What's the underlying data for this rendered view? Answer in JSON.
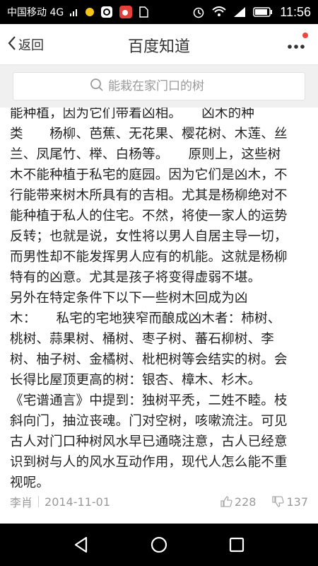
{
  "status": {
    "carrier": "中国移动 4G",
    "network": "4G",
    "time": "11:56"
  },
  "header": {
    "back_label": "返回",
    "title": "百度知道"
  },
  "search": {
    "placeholder": "能栽在家门口的树"
  },
  "article": {
    "lines": [
      "能种植，因为它们带着凶相。　　凶木的种",
      "类　　杨柳、芭蕉、无花果、樱花树、木莲、丝",
      "兰、凤尾竹、榉、白杨等。　　原则上，这些树",
      "木不能种植于私宅的庭园。因为它们是凶木，不",
      "行能带来树木所具有的吉相。尤其是杨柳绝对不",
      "能种植于私人的住宅。不然，将使一家人的运势",
      "反转；也就是说，女性将以男人自居主导一切，",
      "而男性却不能发挥男人应有的机能。这就是杨柳",
      "特有的凶意。尤其是孩子将变得虚弱不堪。",
      "另外在特定条件下以下一些树木回成为凶",
      "木：　　私宅的宅地狭窄而酿成凶木者：柿树、",
      "桃树、蒜果树、桶树、枣子树、蕃石柳树、李",
      "树、柚子树、金橘树、枇杷树等会结实的树。会",
      "长得比屋顶更高的树：银杏、樟木、杉木。",
      "《宅谱通言》中提到：独树平秃，二姓不睦。枝",
      "斜向门，抽泣丧魂。门对空树，咳嗽流注。可见",
      "古人对门口种树风水早已通晓注意，古人已经意",
      "识到树与人的风水互动作用，现代人怎么能不重",
      "视呢。"
    ]
  },
  "meta": {
    "author": "李肖",
    "date": "2014-11-01",
    "likes": "228",
    "dislikes": "137"
  },
  "icons": {
    "accent": "#f0453a"
  }
}
